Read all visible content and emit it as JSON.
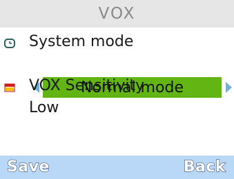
{
  "screen": {
    "title": "VOX"
  },
  "items": [
    {
      "label": "System mode",
      "icon": "clock-icon"
    },
    {
      "label": "VOX Sensitivity",
      "icon": "calendar-icon"
    }
  ],
  "system_mode": {
    "selected_value": "Normal mode"
  },
  "vox_sensitivity": {
    "value": "Low"
  },
  "softkeys": {
    "left": "Save",
    "right": "Back"
  },
  "colors": {
    "selection_bg": "#62b512",
    "softbar_bg": "#b9d7f6",
    "arrow": "#6fb0e0"
  }
}
